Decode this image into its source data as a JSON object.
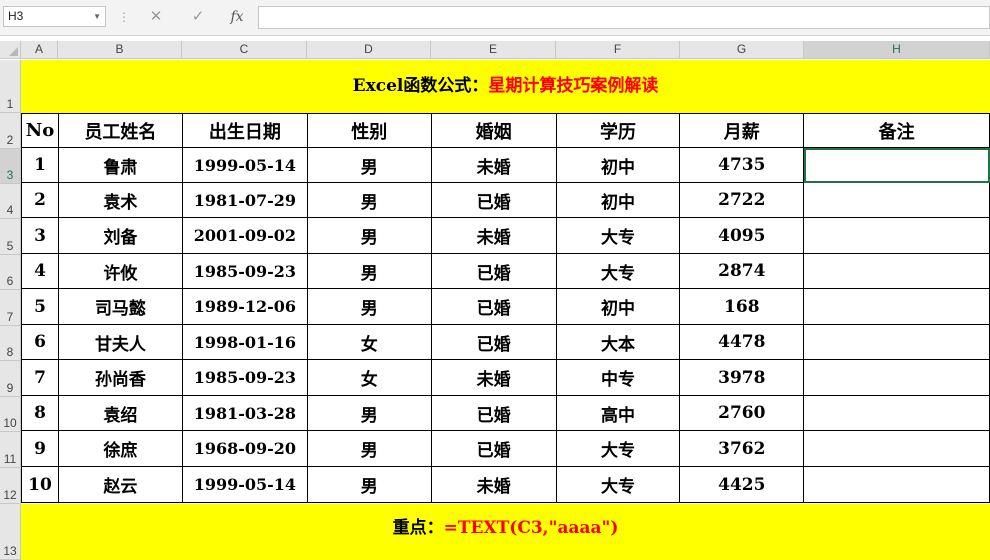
{
  "name_box": "H3",
  "formula_bar": {
    "value": "",
    "fx_label": "fx"
  },
  "columns": [
    "A",
    "B",
    "C",
    "D",
    "E",
    "F",
    "G",
    "H"
  ],
  "row_numbers": [
    "1",
    "2",
    "3",
    "4",
    "5",
    "6",
    "7",
    "8",
    "9",
    "10",
    "11",
    "12",
    "13"
  ],
  "title": {
    "black": "Excel函数公式：",
    "red": "星期计算技巧案例解读"
  },
  "headers": [
    "No",
    "员工姓名",
    "出生日期",
    "性别",
    "婚姻",
    "学历",
    "月薪",
    "备注"
  ],
  "rows": [
    {
      "no": "1",
      "name": "鲁肃",
      "birth": "1999-05-14",
      "gender": "男",
      "marital": "未婚",
      "edu": "初中",
      "salary": "4735",
      "note": ""
    },
    {
      "no": "2",
      "name": "袁术",
      "birth": "1981-07-29",
      "gender": "男",
      "marital": "已婚",
      "edu": "初中",
      "salary": "2722",
      "note": ""
    },
    {
      "no": "3",
      "name": "刘备",
      "birth": "2001-09-02",
      "gender": "男",
      "marital": "未婚",
      "edu": "大专",
      "salary": "4095",
      "note": ""
    },
    {
      "no": "4",
      "name": "许攸",
      "birth": "1985-09-23",
      "gender": "男",
      "marital": "已婚",
      "edu": "大专",
      "salary": "2874",
      "note": ""
    },
    {
      "no": "5",
      "name": "司马懿",
      "birth": "1989-12-06",
      "gender": "男",
      "marital": "已婚",
      "edu": "初中",
      "salary": "168",
      "note": ""
    },
    {
      "no": "6",
      "name": "甘夫人",
      "birth": "1998-01-16",
      "gender": "女",
      "marital": "已婚",
      "edu": "大本",
      "salary": "4478",
      "note": ""
    },
    {
      "no": "7",
      "name": "孙尚香",
      "birth": "1985-09-23",
      "gender": "女",
      "marital": "未婚",
      "edu": "中专",
      "salary": "3978",
      "note": ""
    },
    {
      "no": "8",
      "name": "袁绍",
      "birth": "1981-03-28",
      "gender": "男",
      "marital": "已婚",
      "edu": "高中",
      "salary": "2760",
      "note": ""
    },
    {
      "no": "9",
      "name": "徐庶",
      "birth": "1968-09-20",
      "gender": "男",
      "marital": "已婚",
      "edu": "大专",
      "salary": "3762",
      "note": ""
    },
    {
      "no": "10",
      "name": "赵云",
      "birth": "1999-05-14",
      "gender": "男",
      "marital": "未婚",
      "edu": "大专",
      "salary": "4425",
      "note": ""
    }
  ],
  "footer": {
    "black": "重点：",
    "red": "=TEXT(C3,\"aaaa\")"
  },
  "colors": {
    "banner": "#ffff00",
    "accent_red": "#ff0000",
    "selection": "#217346"
  }
}
